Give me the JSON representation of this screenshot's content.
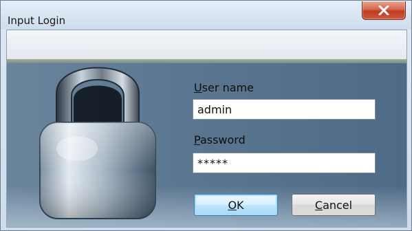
{
  "window": {
    "title": "Input Login"
  },
  "titlebar": {
    "close_icon": "close-x-icon"
  },
  "login": {
    "username_label_accel": "U",
    "username_label_rest": "ser name",
    "username_value": "admin",
    "password_label_accel": "P",
    "password_label_rest": "assword",
    "password_value": "*****"
  },
  "buttons": {
    "ok_accel": "O",
    "ok_rest": "K",
    "cancel_accel": "C",
    "cancel_rest": "ancel"
  },
  "colors": {
    "close_button": "#c7422a",
    "panel": "#5d7893",
    "default_button_border": "#3c7fb1"
  },
  "icons": {
    "lock": "padlock-icon"
  }
}
